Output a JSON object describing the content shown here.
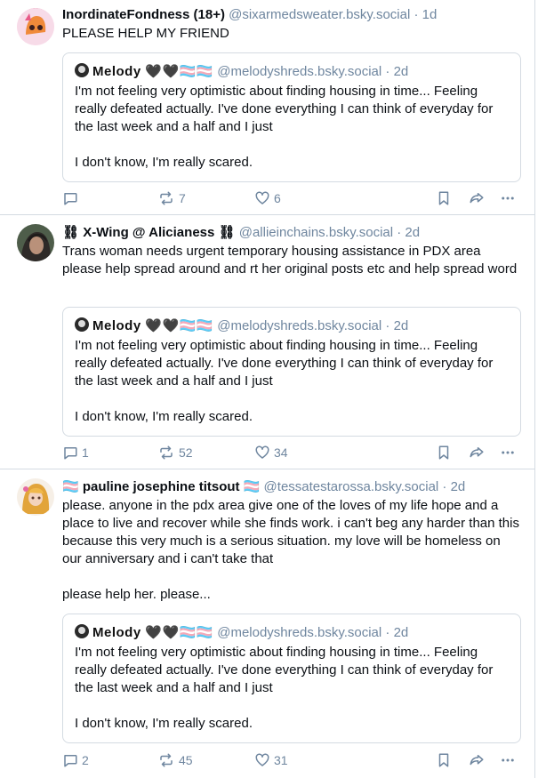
{
  "posts": [
    {
      "author_name": "InordinateFondness (18+)",
      "author_handle": "@sixarmedsweater.bsky.social",
      "time": "· 1d",
      "text": "PLEASE HELP MY FRIEND",
      "quote": {
        "name": "Melody 🖤🖤🏳️‍⚧️🏳️‍⚧️",
        "handle": "@melodyshreds.bsky.social",
        "time": "· 2d",
        "text": "I'm not feeling very optimistic about finding housing in time... Feeling really defeated actually. I've done everything I can think of everyday for the last week and a half and I just\n\nI don't know, I'm really scared."
      },
      "replies": "",
      "reposts": "7",
      "likes": "6"
    },
    {
      "author_name": "⛓ X-Wing @ Alicianess ⛓",
      "author_handle": "@allieinchains.bsky.social",
      "time": "· 2d",
      "text": "Trans woman needs urgent temporary housing assistance in PDX area please help spread around and rt her original posts etc and help spread word",
      "quote": {
        "name": "Melody 🖤🖤🏳️‍⚧️🏳️‍⚧️",
        "handle": "@melodyshreds.bsky.social",
        "time": "· 2d",
        "text": "I'm not feeling very optimistic about finding housing in time... Feeling really defeated actually. I've done everything I can think of everyday for the last week and a half and I just\n\nI don't know, I'm really scared."
      },
      "replies": "1",
      "reposts": "52",
      "likes": "34"
    },
    {
      "author_name": "🏳️‍⚧️ pauline josephine titsout 🏳️‍⚧️",
      "author_handle": "@tessatestarossa.bsky.social",
      "time": "· 2d",
      "text": "please. anyone in the pdx area give one of the loves of my life hope and a place to live and recover while she finds work. i can't beg any harder than this because this very much is a serious situation. my love will be homeless on our anniversary and i can't take that\n\nplease help her. please...",
      "quote": {
        "name": "Melody 🖤🖤🏳️‍⚧️🏳️‍⚧️",
        "handle": "@melodyshreds.bsky.social",
        "time": "· 2d",
        "text": "I'm not feeling very optimistic about finding housing in time... Feeling really defeated actually. I've done everything I can think of everyday for the last week and a half and I just\n\nI don't know, I'm really scared."
      },
      "replies": "2",
      "reposts": "45",
      "likes": "31"
    }
  ],
  "icons": {
    "reply": "reply-icon",
    "repost": "repost-icon",
    "like": "heart-icon",
    "bookmark": "bookmark-icon",
    "share": "share-icon",
    "more": "more-icon"
  },
  "colors": {
    "text": "#0b0f14",
    "muted": "#6f869f",
    "border": "#d4dbe2"
  }
}
